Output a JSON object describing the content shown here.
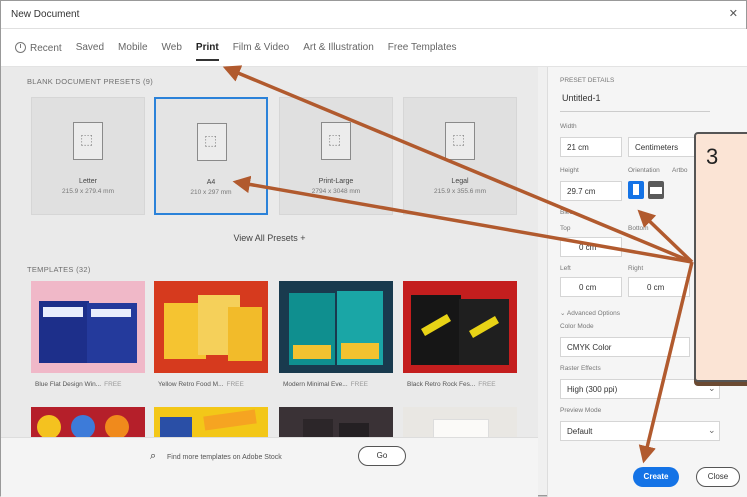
{
  "window": {
    "title": "New Document"
  },
  "tabs": [
    {
      "label": "Recent"
    },
    {
      "label": "Saved"
    },
    {
      "label": "Mobile"
    },
    {
      "label": "Web"
    },
    {
      "label": "Print"
    },
    {
      "label": "Film & Video"
    },
    {
      "label": "Art & Illustration"
    },
    {
      "label": "Free Templates"
    }
  ],
  "presets_section": "BLANK DOCUMENT PRESETS (9)",
  "presets": [
    {
      "name": "Letter",
      "dim": "215.9 x 279.4 mm"
    },
    {
      "name": "A4",
      "dim": "210 x 297 mm"
    },
    {
      "name": "Print-Large",
      "dim": "2794 x 3048 mm"
    },
    {
      "name": "Legal",
      "dim": "215.9 x 355.6 mm"
    }
  ],
  "view_all": "View All Presets +",
  "templates_section": "TEMPLATES (32)",
  "templates": [
    {
      "name": "Blue Flat Design Win...",
      "free": "FREE"
    },
    {
      "name": "Yellow Retro Food M...",
      "free": "FREE"
    },
    {
      "name": "Modern Minimal Eve...",
      "free": "FREE"
    },
    {
      "name": "Black Retro Rock Fes...",
      "free": "FREE"
    }
  ],
  "stock": {
    "search": "Find more templates on Adobe Stock",
    "go": "Go"
  },
  "details": {
    "header": "PRESET DETAILS",
    "doc_name": "Untitled-1",
    "width_label": "Width",
    "width": "21 cm",
    "units": "Centimeters",
    "height_label": "Height",
    "height": "29.7 cm",
    "orientation_label": "Orientation",
    "artboards_label": "Artbo",
    "bleed_label": "Blee",
    "top_label": "Top",
    "top": "0 cm",
    "bottom_label": "Bottom",
    "left_label": "Left",
    "left": "0 cm",
    "right_label": "Right",
    "right": "0 cm",
    "advanced": "Advanced Options",
    "color_mode_label": "Color Mode",
    "color_mode": "CMYK Color",
    "raster_label": "Raster Effects",
    "raster": "High (300 ppi)",
    "preview_label": "Preview Mode",
    "preview": "Default",
    "create": "Create",
    "close": "Close"
  },
  "callout": {
    "number": "3"
  }
}
